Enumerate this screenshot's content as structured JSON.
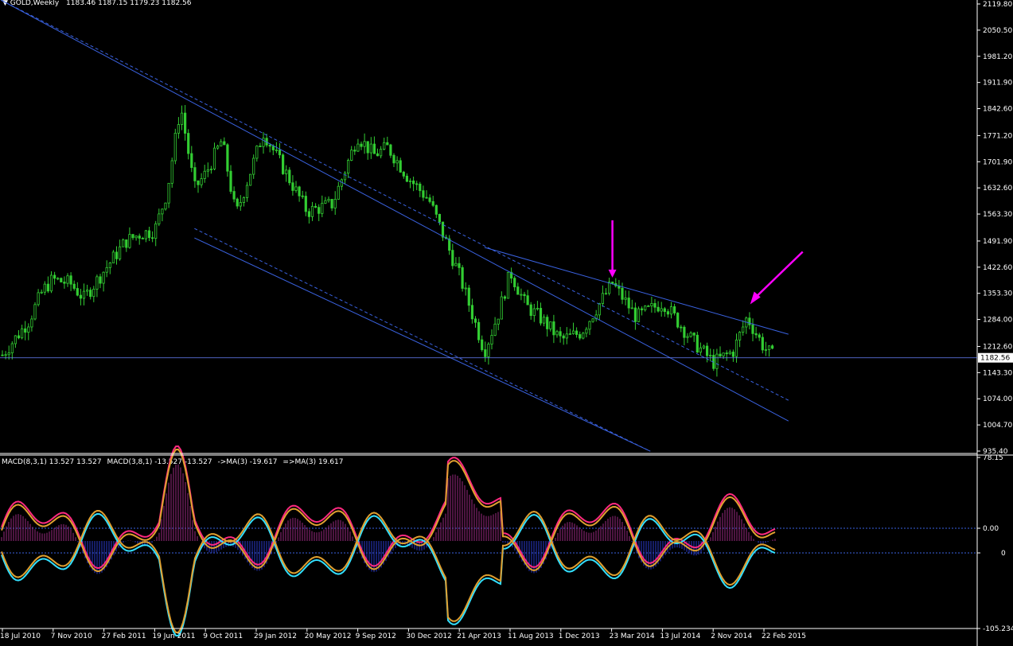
{
  "header": {
    "symbol": "GOLD,Weekly",
    "ohlc": "1183.46 1187.15 1179.23 1182.56"
  },
  "indicator_header": {
    "macd1": "MACD(8,3,1) 13.527 13.527",
    "macd2": "MACD(3,8,1) -13.527 -13.527",
    "ma1": "->MA(3) -19.617",
    "ma2": "=>MA(3) 19.617"
  },
  "colors": {
    "candle": "#32cd32",
    "trendline": "#3a62e0",
    "arrow": "#ff00ff",
    "macd_pos": "#ff2a80",
    "macd_neg": "#33e0ff",
    "signal": "#e0a030",
    "hist_pos": "#9a2a80",
    "hist_neg": "#2a3acc"
  },
  "chart_data": [
    {
      "type": "candlestick",
      "title": "GOLD,Weekly",
      "current_price": "1182.56",
      "ylim": [
        935.4,
        2119.8
      ],
      "y_ticks": [
        "2119.80",
        "2050.50",
        "1981.20",
        "1911.90",
        "1842.60",
        "1771.20",
        "1701.90",
        "1632.60",
        "1563.30",
        "1491.90",
        "1422.60",
        "1353.30",
        "1284.00",
        "1212.60",
        "1143.30",
        "1074.00",
        "1004.70",
        "935.40"
      ],
      "x_ticks": [
        "18 Jul 2010",
        "7 Nov 2010",
        "27 Feb 2011",
        "19 Jun 2011",
        "9 Oct 2011",
        "29 Jan 2012",
        "20 May 2012",
        "9 Sep 2012",
        "30 Dec 2012",
        "21 Apr 2013",
        "11 Aug 2013",
        "1 Dec 2013",
        "23 Mar 2014",
        "13 Jul 2014",
        "2 Nov 2014",
        "22 Feb 2015"
      ],
      "close_path": [
        [
          "18 Jul 2010",
          1190
        ],
        [
          "Sep 2010",
          1280
        ],
        [
          "Oct 2010",
          1360
        ],
        [
          "7 Nov 2010",
          1390
        ],
        [
          "Dec 2010",
          1380
        ],
        [
          "Jan 2011",
          1340
        ],
        [
          "27 Feb 2011",
          1410
        ],
        [
          "Apr 2011",
          1490
        ],
        [
          "May 2011",
          1510
        ],
        [
          "19 Jun 2011",
          1520
        ],
        [
          "Jul 2011",
          1620
        ],
        [
          "Aug 2011",
          1850
        ],
        [
          "Sep 2011",
          1630
        ],
        [
          "9 Oct 2011",
          1670
        ],
        [
          "Nov 2011",
          1760
        ],
        [
          "Dec 2011",
          1560
        ],
        [
          "29 Jan 2012",
          1720
        ],
        [
          "Feb 2012",
          1780
        ],
        [
          "20 May 2012",
          1570
        ],
        [
          "Jul 2012",
          1590
        ],
        [
          "9 Sep 2012",
          1770
        ],
        [
          "Oct 2012",
          1720
        ],
        [
          "Nov 2012",
          1740
        ],
        [
          "30 Dec 2012",
          1660
        ],
        [
          "Feb 2013",
          1600
        ],
        [
          "21 Apr 2013",
          1400
        ],
        [
          "Jun 2013",
          1200
        ],
        [
          "Jul 2013",
          1300
        ],
        [
          "11 Aug 2013",
          1410
        ],
        [
          "Sep 2013",
          1320
        ],
        [
          "Oct 2013",
          1290
        ],
        [
          "1 Dec 2013",
          1230
        ],
        [
          "Jan 2014",
          1250
        ],
        [
          "23 Mar 2014",
          1380
        ],
        [
          "May 2014",
          1290
        ],
        [
          "13 Jul 2014",
          1330
        ],
        [
          "Sep 2014",
          1230
        ],
        [
          "2 Nov 2014",
          1170
        ],
        [
          "Dec 2014",
          1200
        ],
        [
          "Jan 2015",
          1290
        ],
        [
          "22 Feb 2015",
          1210
        ],
        [
          "Mar 2015",
          1183
        ]
      ],
      "trendlines": [
        {
          "desc": "upper resistance",
          "from": [
            "Jul 2010",
            2130
          ],
          "to": [
            "Apr 2015",
            1015
          ]
        },
        {
          "desc": "upper resistance dashed",
          "from": [
            "Jul 2010",
            2130
          ],
          "to": [
            "Apr 2015",
            1070
          ],
          "dashed": true
        },
        {
          "desc": "lower channel",
          "from": [
            "Sep 2011",
            1500
          ],
          "to": [
            "Jun 2014",
            935
          ]
        },
        {
          "desc": "lower channel dashed",
          "from": [
            "Sep 2011",
            1525
          ],
          "to": [
            "Jun 2014",
            935
          ],
          "dashed": true
        },
        {
          "desc": "secondary resistance",
          "from": [
            "Jun 2013",
            1475
          ],
          "to": [
            "Apr 2015",
            1245
          ]
        }
      ],
      "arrows": [
        {
          "direction": "down",
          "at": "23 Mar 2014",
          "price": 1395
        },
        {
          "direction": "down-left",
          "at": "Jan 2015",
          "price": 1320
        }
      ]
    },
    {
      "type": "line",
      "title": "MACD",
      "ylim": [
        -105.234,
        78.15
      ],
      "y_ticks": [
        "78.15",
        "0.00",
        "0",
        "-105.234"
      ],
      "series": [
        {
          "name": "MACD(8,3,1)",
          "color": "#ff2a80"
        },
        {
          "name": "MACD(3,8,1)",
          "color": "#33e0ff"
        },
        {
          "name": "->MA(3)",
          "color": "#e0a030"
        },
        {
          "name": "=>MA(3)",
          "color": "#e0a030"
        }
      ]
    }
  ]
}
